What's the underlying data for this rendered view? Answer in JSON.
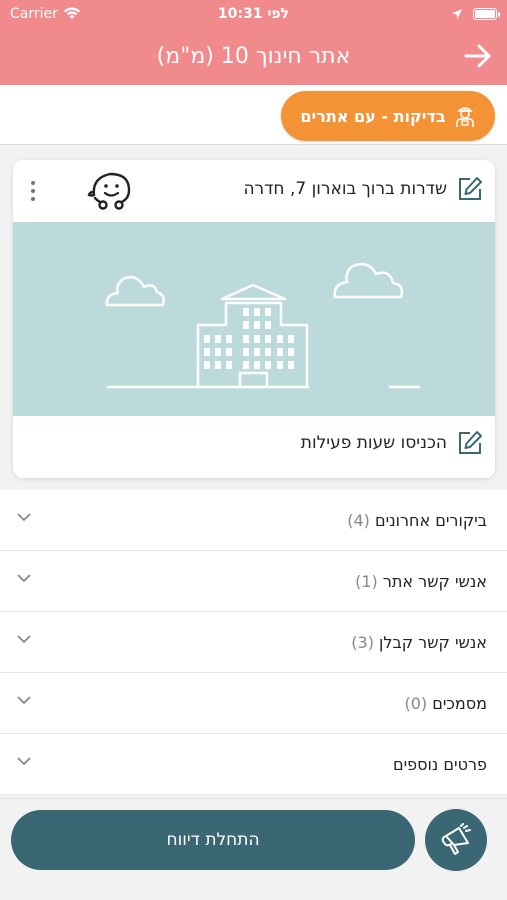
{
  "status_bar": {
    "carrier": "Carrier",
    "time": "10:31 לפי"
  },
  "nav": {
    "title": "אתר חינוך 10 (מ\"מ)"
  },
  "chip": {
    "label": "בדיקות - עם אתרים"
  },
  "card": {
    "address": "שדרות ברוך בוארון 7, חדרה",
    "hours_prompt": "הכניסו שעות פעילות"
  },
  "accordion": [
    {
      "label": "ביקורים אחרונים",
      "count": "(4)"
    },
    {
      "label": "אנשי קשר אתר",
      "count": "(1)"
    },
    {
      "label": "אנשי קשר קבלן",
      "count": "(3)"
    },
    {
      "label": "מסמכים",
      "count": "(0)"
    },
    {
      "label": "פרטים נוספים",
      "count": ""
    }
  ],
  "bottom": {
    "start_label": "התחלת דיווח"
  },
  "colors": {
    "header": "#f08a8c",
    "chip": "#f49336",
    "primary": "#3b6775",
    "illustration_bg": "#bcd9dc"
  },
  "icons": {
    "back": "arrow-right-icon",
    "chip": "inspector-icon",
    "edit": "edit-icon",
    "waze": "waze-icon",
    "more": "more-vertical-icon",
    "chevron": "chevron-down-icon",
    "fab": "megaphone-icon"
  }
}
